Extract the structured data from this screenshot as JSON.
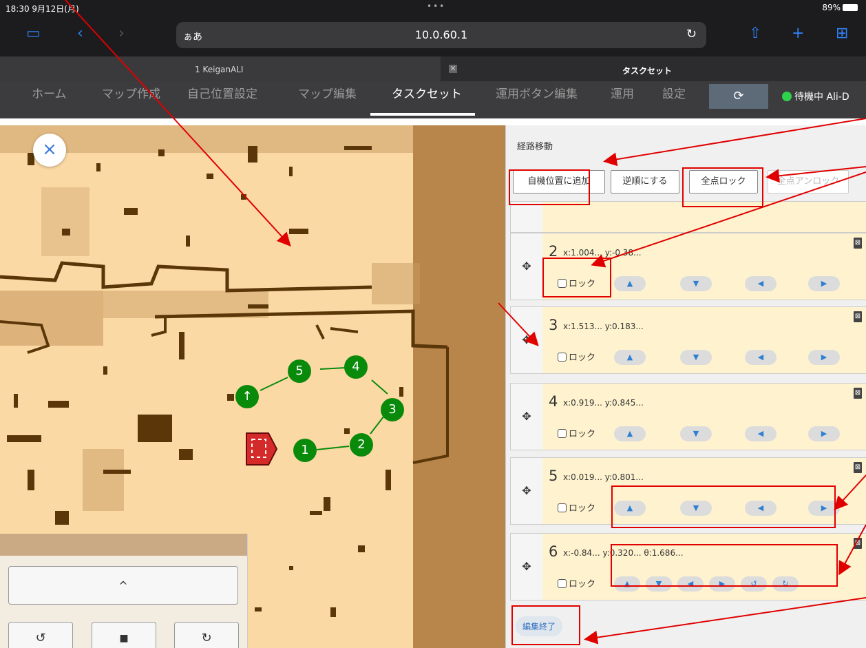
{
  "status_bar": {
    "time": "18:30 9月12日(月)",
    "dots": "•••",
    "battery": "89%"
  },
  "browser": {
    "aa": "ぁあ",
    "url": "10.0.60.1",
    "reload": "↻",
    "tab1": "1 KeiganALI",
    "tab2": "タスクセット",
    "tab_close": "✕"
  },
  "nav": {
    "items": [
      "ホーム",
      "マップ作成",
      "自己位置設定",
      "マップ編集",
      "タスクセット",
      "運用ボタン編集",
      "運用",
      "設定"
    ],
    "active_index": 4,
    "sync_icon": "⟳",
    "status": "待機中",
    "device": "Ali-D"
  },
  "map": {
    "close_icon": "×",
    "markers": [
      {
        "label": "1"
      },
      {
        "label": "2"
      },
      {
        "label": "3"
      },
      {
        "label": "4"
      },
      {
        "label": "5"
      },
      {
        "label": "↑"
      }
    ],
    "marker_color": "#0a8a0a",
    "floor_color": "#fbd9a5",
    "wall_color": "#5a3608",
    "unknown_color": "#b8864a",
    "controls": {
      "up": "^",
      "rotate_left": "↺",
      "stop": "■",
      "rotate_right": "↻"
    }
  },
  "panel": {
    "title": "経路移動",
    "buttons": {
      "add_current": "自機位置に追加",
      "reverse": "逆順にする",
      "lock_all": "全点ロック",
      "unlock_all": "全点アンロック"
    },
    "lock_label": "ロック",
    "drag_icon": "✥",
    "trash_icon": "trash-icon",
    "points": [
      {
        "num": "2",
        "coord": "x:1.004... y:-0.38..."
      },
      {
        "num": "3",
        "coord": "x:1.513... y:0.183..."
      },
      {
        "num": "4",
        "coord": "x:0.919... y:0.845..."
      },
      {
        "num": "5",
        "coord": "x:0.019... y:0.801..."
      },
      {
        "num": "6",
        "coord": "x:-0.84... y:0.320... θ:1.686..."
      }
    ],
    "dir_icons": [
      "▲",
      "▼",
      "◀",
      "▶"
    ],
    "rot_icons": [
      "↺",
      "↻"
    ],
    "end_edit": "編集終了"
  },
  "colors": {
    "accent": "#2f7ff5",
    "annotation": "#e00000",
    "status_dot": "#2fd14b"
  }
}
